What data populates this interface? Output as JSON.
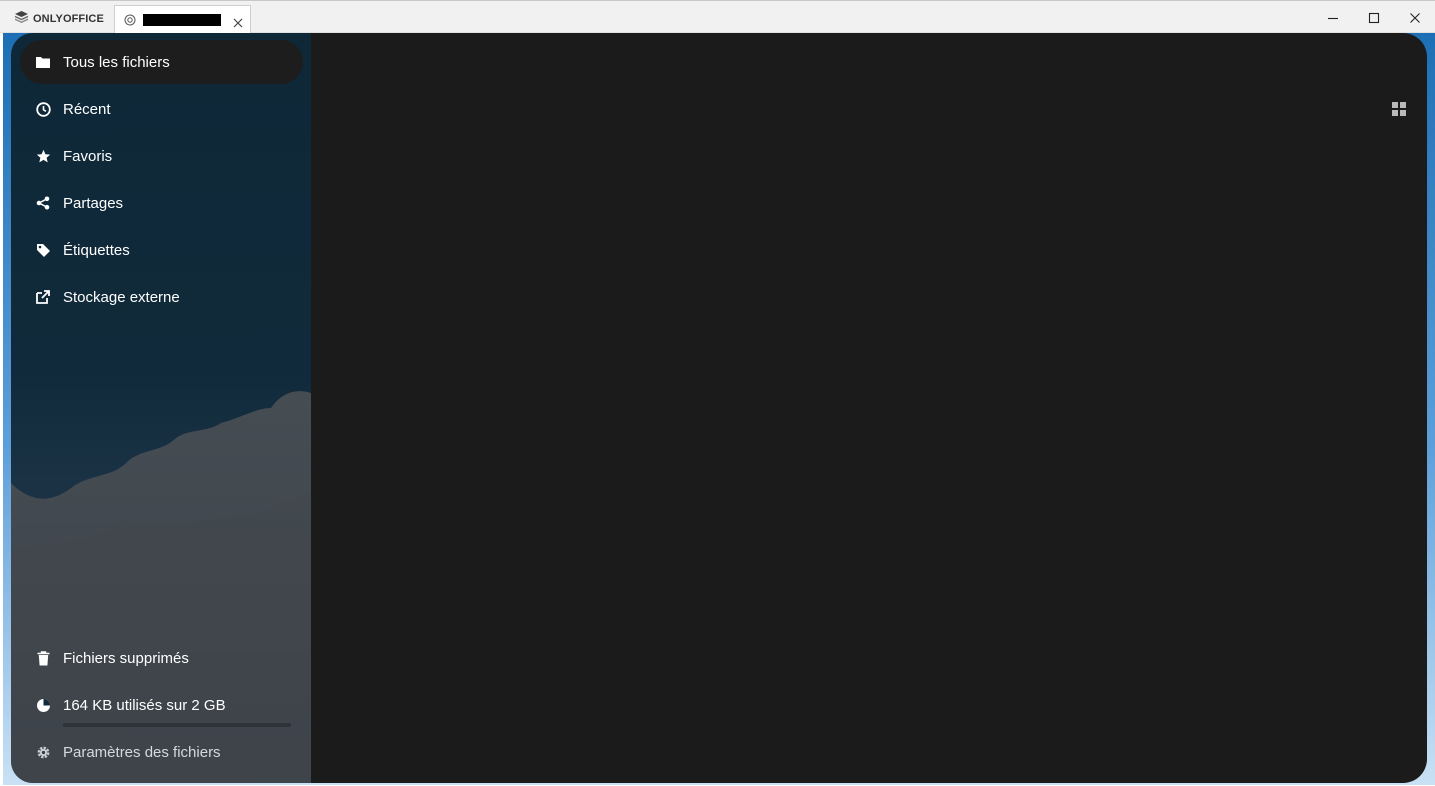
{
  "app": {
    "brand_label": "ONLYOFFICE",
    "tab_title": ""
  },
  "sidebar": {
    "items": [
      {
        "label": "Tous les fichiers",
        "icon": "folder-icon",
        "active": true
      },
      {
        "label": "Récent",
        "icon": "clock-icon"
      },
      {
        "label": "Favoris",
        "icon": "star-icon"
      },
      {
        "label": "Partages",
        "icon": "share-icon"
      },
      {
        "label": "Étiquettes",
        "icon": "tag-icon"
      },
      {
        "label": "Stockage externe",
        "icon": "external-link-icon"
      }
    ],
    "bottom": {
      "trash_label": "Fichiers supprimés",
      "quota_label": "164 KB utilisés sur 2 GB",
      "quota_fraction": 0.0001,
      "settings_label": "Paramètres des fichiers"
    }
  },
  "main": {
    "view_toggle_icon": "grid-view-icon"
  },
  "colors": {
    "sidebar_bg": "#0e2838",
    "main_bg": "#1b1b1b",
    "active_item_bg": "#1d1d1d",
    "accent": "#4a8fd0"
  }
}
